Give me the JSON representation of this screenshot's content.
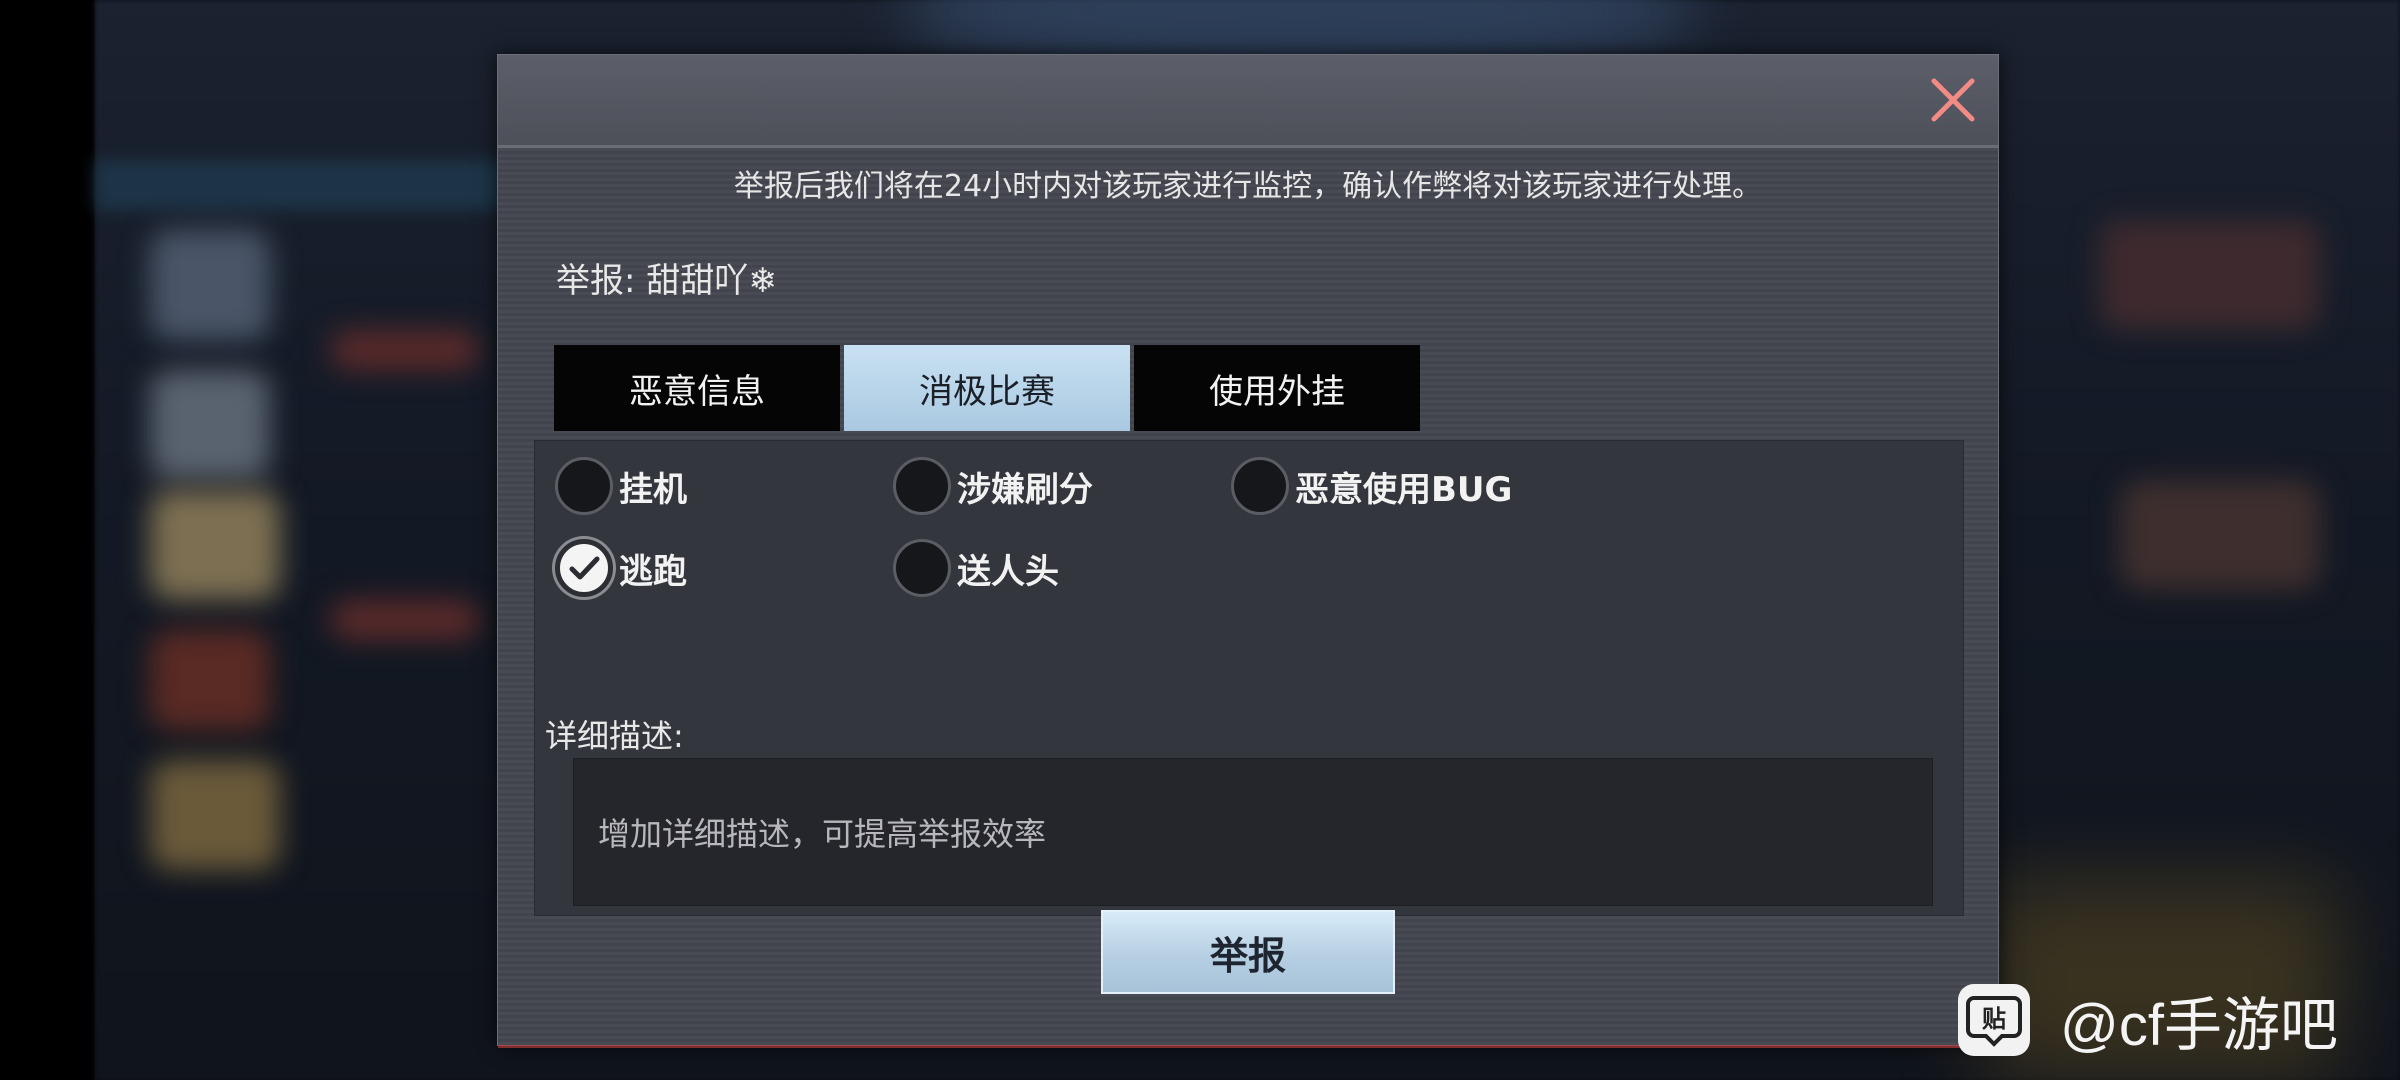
{
  "dialog": {
    "notice": "举报后我们将在24小时内对该玩家进行监控，确认作弊将对该玩家进行处理。",
    "target_label": "举报: 甜甜吖❄",
    "tabs": [
      {
        "label": "恶意信息",
        "active": false
      },
      {
        "label": "消极比赛",
        "active": true
      },
      {
        "label": "使用外挂",
        "active": false
      }
    ],
    "options": [
      {
        "label": "挂机",
        "checked": false
      },
      {
        "label": "涉嫌刷分",
        "checked": false
      },
      {
        "label": "恶意使用BUG",
        "checked": false
      },
      {
        "label": "逃跑",
        "checked": true
      },
      {
        "label": "送人头",
        "checked": false
      }
    ],
    "description_label": "详细描述:",
    "description_placeholder": "增加详细描述，可提高举报效率",
    "submit_label": "举报",
    "close_icon": "close-icon"
  },
  "watermark": {
    "icon": "tieba-icon",
    "text": "@cf手游吧"
  },
  "colors": {
    "tab_active": "#b8d5ea",
    "tab_inactive": "#050506",
    "button": "#c6dcee",
    "close_icon": "#f28a86"
  }
}
